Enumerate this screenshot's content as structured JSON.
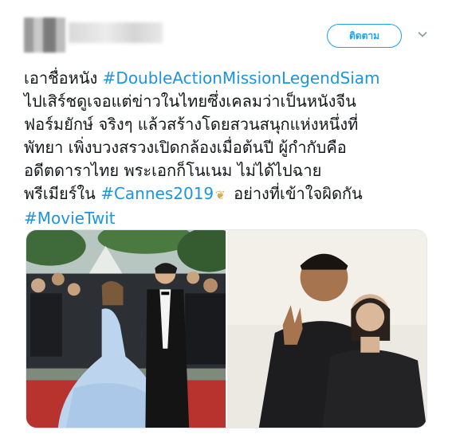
{
  "header": {
    "follow_label": "ติดตาม",
    "avatar_icon": "avatar-blurred",
    "name_icon": "name-blurred",
    "menu_icon": "chevron-down-icon"
  },
  "tweet": {
    "lines": [
      [
        "เอาชื่อหนัง ",
        "#DoubleActionMissionLegendSiam"
      ],
      [
        "ไปเสิร์ชดูเจอแต่ข่าวในไทยซึ่งเคลมว่าเป็นหนังจีน"
      ],
      [
        "ฟอร์มยักษ์ จริงๆ แล้วสร้างโดยสวนสนุกแห่งหนึ่งที่"
      ],
      [
        "พัทยา เพิ่งบวงสรวงเปิดกล้องเมื่อต้นปี ผู้กำกับคือ"
      ],
      [
        "อดีตดาราไทย พระเอกก็โนเนม ไม่ได้ไปฉาย"
      ],
      [
        "พรีเมียร์ใน ",
        "#Cannes2019",
        " อย่างที่เข้าใจผิดกัน"
      ],
      [
        "#MovieTwit"
      ]
    ],
    "cannes_emoji": "palm-leaf-icon"
  },
  "media": {
    "left_photo": "red-carpet-photo",
    "right_photo": "couple-portrait-photo"
  },
  "colors": {
    "accent": "#1da1f2",
    "hashtag": "#1b95e0",
    "text": "#14171a"
  }
}
